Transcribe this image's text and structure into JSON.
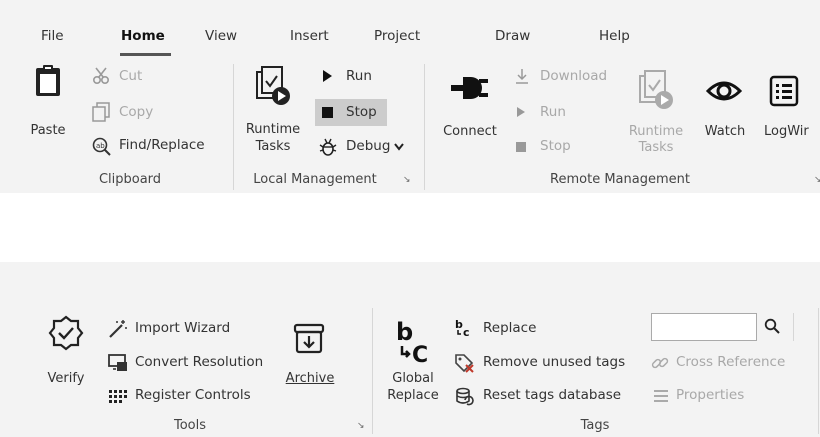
{
  "tabs": [
    "File",
    "Home",
    "View",
    "Insert",
    "Project",
    "Draw",
    "Help"
  ],
  "clipboard": {
    "paste": "Paste",
    "cut": "Cut",
    "copy": "Copy",
    "find_replace": "Find/Replace",
    "group": "Clipboard"
  },
  "local": {
    "runtime_tasks": [
      "Runtime",
      "Tasks"
    ],
    "run": "Run",
    "stop": "Stop",
    "debug": "Debug",
    "group": "Local Management"
  },
  "remote": {
    "connect": "Connect",
    "download": "Download",
    "run": "Run",
    "stop": "Stop",
    "runtime_tasks": [
      "Runtime",
      "Tasks"
    ],
    "watch": "Watch",
    "logwin": "LogWir",
    "group": "Remote Management"
  },
  "tools": {
    "verify": "Verify",
    "import_wizard": "Import Wizard",
    "convert_resolution": "Convert Resolution",
    "register_controls": "Register Controls",
    "archive": "Archive",
    "group": "Tools"
  },
  "tags": {
    "global_replace": [
      "Global",
      "Replace"
    ],
    "replace": "Replace",
    "remove_unused": "Remove unused tags",
    "reset_db": "Reset tags database",
    "cross_reference": "Cross Reference",
    "properties": "Properties",
    "search_value": "",
    "group": "Tags"
  },
  "colors": {
    "ribbon_bg": "#f3f3f3",
    "disabled": "#a8a8a8",
    "stop_highlight": "#cccccc"
  }
}
